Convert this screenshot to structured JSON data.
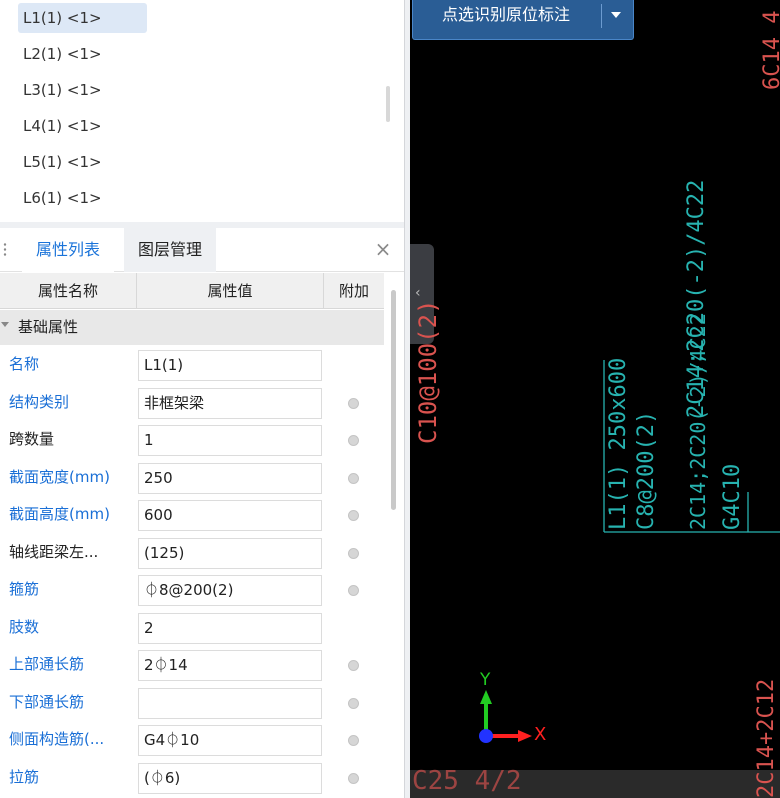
{
  "beam_list": {
    "items": [
      {
        "label": "L1(1) <1>",
        "selected": true
      },
      {
        "label": "L2(1) <1>",
        "selected": false
      },
      {
        "label": "L3(1) <1>",
        "selected": false
      },
      {
        "label": "L4(1) <1>",
        "selected": false
      },
      {
        "label": "L5(1) <1>",
        "selected": false
      },
      {
        "label": "L6(1) <1>",
        "selected": false
      }
    ]
  },
  "tabs": {
    "properties": "属性列表",
    "layers": "图层管理",
    "close": "×"
  },
  "table": {
    "headers": {
      "name": "属性名称",
      "value": "属性值",
      "extra": "附加"
    },
    "group": "基础属性",
    "rows": [
      {
        "name": "名称",
        "value": "L1(1)",
        "blue": true,
        "dot": false
      },
      {
        "name": "结构类别",
        "value": "非框架梁",
        "blue": true,
        "dot": true
      },
      {
        "name": "跨数量",
        "value": "1",
        "blue": false,
        "dot": true
      },
      {
        "name": "截面宽度(mm)",
        "value": "250",
        "blue": true,
        "dot": true
      },
      {
        "name": "截面高度(mm)",
        "value": "600",
        "blue": true,
        "dot": true
      },
      {
        "name": "轴线距梁左...",
        "value": "(125)",
        "blue": false,
        "dot": true
      },
      {
        "name": "箍筋",
        "value": "⏀8@200(2)",
        "blue": true,
        "dot": true
      },
      {
        "name": "肢数",
        "value": "2",
        "blue": true,
        "dot": false
      },
      {
        "name": "上部通长筋",
        "value": "2⏀14",
        "blue": true,
        "dot": true
      },
      {
        "name": "下部通长筋",
        "value": "",
        "blue": true,
        "dot": true
      },
      {
        "name": "侧面构造筋(...",
        "value": "G4⏀10",
        "blue": true,
        "dot": true
      },
      {
        "name": "拉筋",
        "value": "(⏀6)",
        "blue": true,
        "dot": true
      }
    ]
  },
  "cad": {
    "recognize_button": "点选识别原位标注",
    "axis_x": "X",
    "axis_y": "Y",
    "colors": {
      "red": "#d9534f",
      "teal": "#27b3b0",
      "axis_x": "#ff2020",
      "axis_y": "#22cc22",
      "origin": "#2233ff"
    },
    "texts": {
      "top_right": "6C14 4",
      "left_vertical": "C10@100(2)",
      "support": "2C14;2C20(-2)/4C22",
      "beam_name": "L1(1) 250x600",
      "beam_stirrup": "C8@200(2)",
      "beam_top": "2C14;2C20(-2)/4C22",
      "beam_side": "G4C10",
      "bottom_right": "2C14+2C12",
      "bottom_left": "C25 4/2"
    }
  }
}
